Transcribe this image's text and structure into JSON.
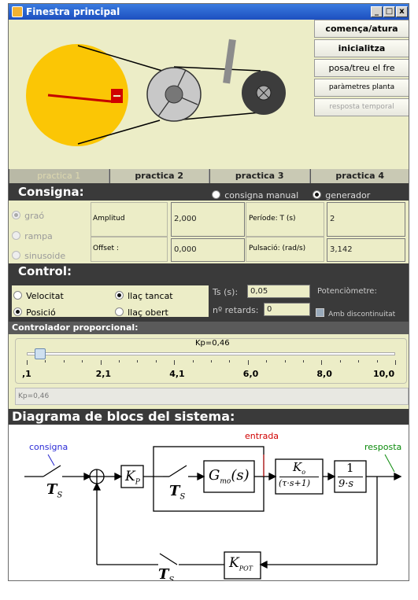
{
  "window": {
    "title": "Finestra principal",
    "min": "_",
    "max": "□",
    "close": "x"
  },
  "buttons": {
    "start": "començа/atura",
    "init": "inicialitza",
    "brake": "posa/treu el fre",
    "params": "paràmetres planta",
    "response": "resposta temporal"
  },
  "tabs": [
    "practica 1",
    "practica 2",
    "practica 3",
    "practica 4"
  ],
  "consigna": {
    "title": "Consigna:",
    "manual": "consigna manual",
    "generator": "generador",
    "signals": [
      "graó",
      "rampa",
      "sinusoide"
    ],
    "amplitude_label": "Amplitud",
    "amplitude_value": "2,000",
    "offset_label": "Offset :",
    "offset_value": "0,000",
    "period_label": "Període: T (s)",
    "period_value": "2",
    "pulsation_label": "Pulsació: (rad/s)",
    "pulsation_value": "3,142"
  },
  "control": {
    "title": "Control:",
    "velocity": "Velocitat",
    "position": "Posició",
    "closed_loop": "llaç tancat",
    "open_loop": "llaç obert",
    "ts_label": "Ts (s):",
    "ts_value": "0,05",
    "delays_label": "nº retards:",
    "delays_value": "0",
    "potentiometer": "Potenciòmetre:",
    "discontinuity": "Amb discontinuitat"
  },
  "controller": {
    "title": "Controlador proporcional:",
    "slider_label": "Kp=0,46",
    "kp": 0.46,
    "min": 0.1,
    "max": 10,
    "ticks": [
      ",1",
      "2,1",
      "4,1",
      "6,0",
      "8,0",
      "10,0"
    ],
    "status": "Kp=0,46"
  },
  "diagram": {
    "title": "Diagrama de blocs del sistema:",
    "consigna": "consigna",
    "entrada": "entrada",
    "resposta": "resposta",
    "Ts": "T",
    "Ts_sub": "S",
    "Kp": "K",
    "Kp_sub": "P",
    "G": "G",
    "G_sub": "mo",
    "G_arg": "(s)",
    "K0": "K",
    "K0_sub": "o",
    "den1": "(τ·s+1)",
    "num2": "1",
    "den2": "9·s",
    "Kpot": "K",
    "Kpot_sub": "POT"
  }
}
